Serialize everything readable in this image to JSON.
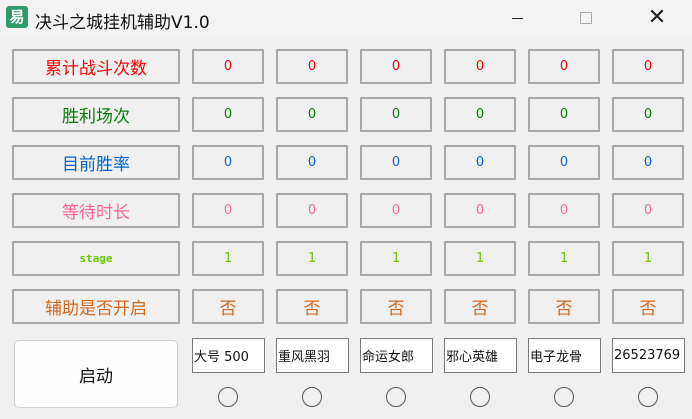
{
  "window": {
    "title": "决斗之城挂机辅助V1.0",
    "icon": "app-logo-icon",
    "minimize_icon": "minimize-icon",
    "maximize_icon": "maximize-icon",
    "close_icon": "close-icon"
  },
  "rows": [
    {
      "label": "累计战斗次数",
      "values": [
        "0",
        "0",
        "0",
        "0",
        "0",
        "0"
      ],
      "color": "#ff0000"
    },
    {
      "label": "胜利场次",
      "values": [
        "0",
        "0",
        "0",
        "0",
        "0",
        "0"
      ],
      "color": "#008000"
    },
    {
      "label": "目前胜率",
      "values": [
        "0",
        "0",
        "0",
        "0",
        "0",
        "0"
      ],
      "color": "#0064c8"
    },
    {
      "label": "等待时长",
      "values": [
        "0",
        "0",
        "0",
        "0",
        "0",
        "0"
      ],
      "color": "#ff6496"
    },
    {
      "label": "stage",
      "values": [
        "1",
        "1",
        "1",
        "1",
        "1",
        "1"
      ],
      "color": "#64c800"
    },
    {
      "label": "辅助是否开启",
      "values": [
        "否",
        "否",
        "否",
        "否",
        "否",
        "否"
      ],
      "color": "#d2691e"
    }
  ],
  "start_button": "启动",
  "accounts": [
    "大号 500",
    "重风黑羽",
    "命运女郎",
    "邪心英雄",
    "电子龙骨",
    "26523769"
  ],
  "radios": [
    false,
    false,
    false,
    false,
    false,
    false
  ]
}
